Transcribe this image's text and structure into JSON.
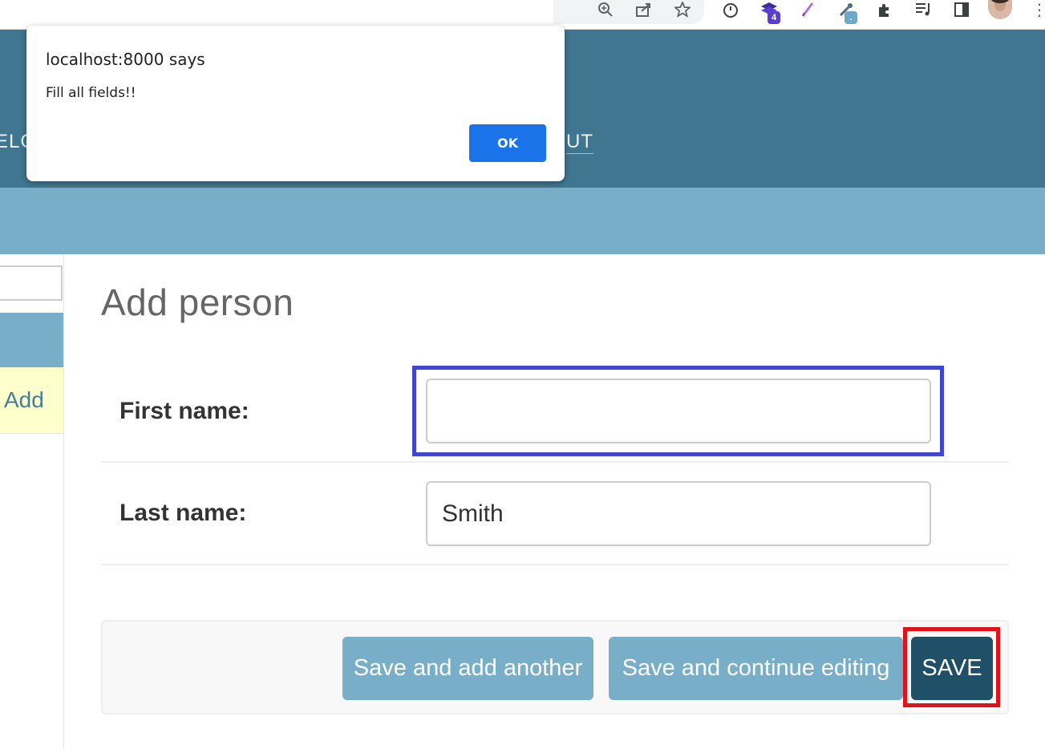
{
  "browser": {
    "toolbar_icons": [
      "zoom-icon",
      "share-icon",
      "bookmark-star-icon",
      "timer-extension-icon",
      "stack-extension-icon",
      "pen-extension-icon",
      "eyedropper-extension-icon",
      "extensions-puzzle-icon",
      "reading-list-icon",
      "side-panel-icon",
      "profile-avatar",
      "menu-kebab-icon"
    ],
    "stack_extension_badge": "4",
    "eyedropper_extension_badge": "."
  },
  "header": {
    "branding_fragment": "ELC",
    "logout_fragment": "UT"
  },
  "sidebar": {
    "add_link_label": "Add"
  },
  "main": {
    "title": "Add person",
    "fields": {
      "first_name": {
        "label": "First name:",
        "value": ""
      },
      "last_name": {
        "label": "Last name:",
        "value": "Smith"
      }
    },
    "buttons": {
      "save_add_another": "Save and add another",
      "save_continue": "Save and continue editing",
      "save": "SAVE"
    }
  },
  "dialog": {
    "title": "localhost:8000 says",
    "message": "Fill all fields!!",
    "ok_label": "OK"
  },
  "colors": {
    "header_bg": "#417690",
    "breadcrumb_bg": "#79aec8",
    "primary_button": "#205067",
    "secondary_button": "#79aec8",
    "dialog_ok": "#1a73e8",
    "annotation_blue": "#3f48cc",
    "annotation_red": "#e0131b"
  }
}
